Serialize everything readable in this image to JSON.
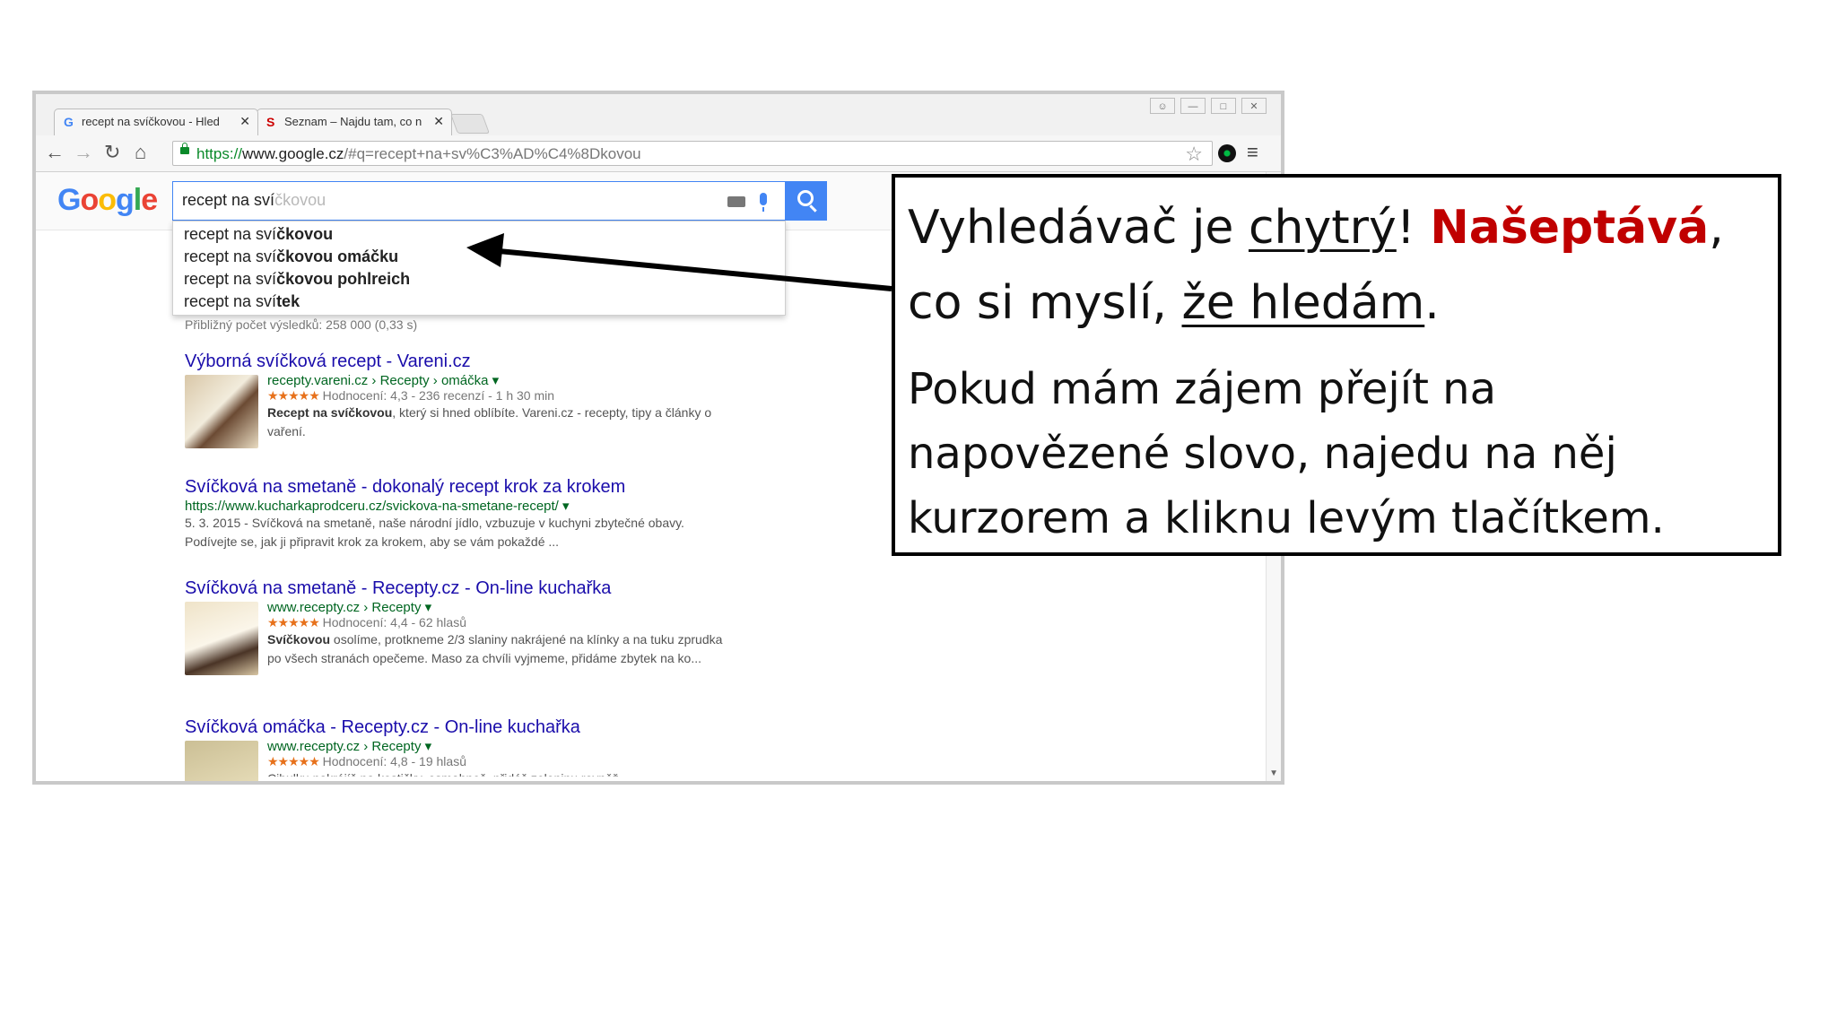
{
  "browser": {
    "tabs": [
      {
        "label": "recept na svíčkovou - Hled",
        "favicon": "G",
        "close": "✕"
      },
      {
        "label": "Seznam – Najdu tam, co n",
        "favicon": "S",
        "close": "✕"
      }
    ],
    "window_controls": [
      "person-icon",
      "minimize-icon",
      "restore-icon",
      "close-icon"
    ],
    "url": {
      "scheme": "https://",
      "host": "www.google.cz",
      "path": "/#q=recept+na+sv%C3%AD%C4%8Dkovou"
    }
  },
  "google": {
    "logo_letters": [
      {
        "ch": "G",
        "color": "#4285f4"
      },
      {
        "ch": "o",
        "color": "#ea4335"
      },
      {
        "ch": "o",
        "color": "#fbbc05"
      },
      {
        "ch": "g",
        "color": "#4285f4"
      },
      {
        "ch": "l",
        "color": "#34a853"
      },
      {
        "ch": "e",
        "color": "#ea4335"
      }
    ],
    "query_typed": "recept na sví",
    "query_hint": "čkovou",
    "suggestions": [
      {
        "prefix": "recept na sví",
        "bold": "čkovou"
      },
      {
        "prefix": "recept na sví",
        "bold": "čkovou omáčku"
      },
      {
        "prefix": "recept na sví",
        "bold": "čkovou pohlreich"
      },
      {
        "prefix": "recept na sví",
        "bold": "tek"
      }
    ],
    "stats": "Přibližný počet výsledků: 258 000 (0,33 s)",
    "results": [
      {
        "title": "Výborná svíčková recept - Vareni.cz",
        "cite": "recepty.vareni.cz › Recepty › omáčka ▾",
        "stars": "★★★★★",
        "rating": "Hodnocení: 4,3 - 236 recenzí - 1 h 30 min",
        "snippet_bold": "Recept na svíčkovou",
        "snippet": ", který si hned oblíbíte. Vareni.cz - recepty, tipy a články o vaření."
      },
      {
        "title": "Svíčková na smetaně - dokonalý recept krok za krokem",
        "cite": "https://www.kucharkaprodceru.cz/svickova-na-smetane-recept/ ▾",
        "snippet_bold": "",
        "snippet": "5. 3. 2015 - Svíčková na smetaně, naše národní jídlo, vzbuzuje v kuchyni zbytečné obavy. Podívejte se, jak ji připravit krok za krokem, aby se vám pokaždé ..."
      },
      {
        "title": "Svíčková na smetaně - Recepty.cz - On-line kuchařka",
        "cite": "www.recepty.cz › Recepty ▾",
        "stars": "★★★★★",
        "rating": "Hodnocení: 4,4 - 62 hlasů",
        "snippet_bold": "Svíčkovou",
        "snippet": " osolíme, protkneme 2/3 slaniny nakrájené na klínky a na tuku zprudka po všech stranách opečeme. Maso za chvíli vyjmeme, přidáme zbytek na ko..."
      },
      {
        "title": "Svíčková omáčka - Recepty.cz - On-line kuchařka",
        "cite": "www.recepty.cz › Recepty ▾",
        "stars": "★★★★★",
        "rating": "Hodnocení: 4,8 - 19 hlasů",
        "snippet_bold": "",
        "snippet": "Cibulku nakrájíš na kostičky, osmahneš, přidáš zeleninu rovněž"
      }
    ]
  },
  "callout": {
    "h1": "Vyhledávač je ",
    "h1_u": "chytrý",
    "h1_excl": "! ",
    "h1_red": "Našeptává",
    "h1_comma": ",",
    "h2": "co si myslí, ",
    "h2_u": "že hledám",
    "h2_dot": ".",
    "body_lines": [
      "Pokud mám zájem přejít na",
      "napovězené slovo, najedu na něj",
      "kurzorem a kliknu levým tlačítkem."
    ]
  }
}
